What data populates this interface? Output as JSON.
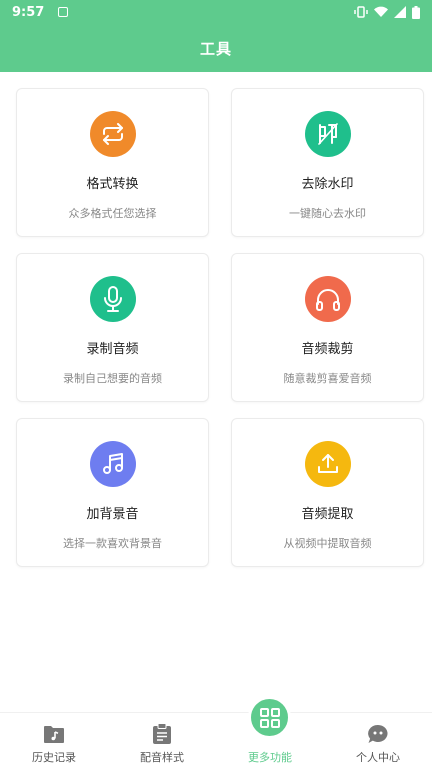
{
  "status_bar": {
    "time": "9:57"
  },
  "header": {
    "title": "工具"
  },
  "tools": [
    {
      "name": "格式转换",
      "desc": "众多格式任您选择",
      "icon": "format-convert-icon",
      "color": "#f08a2a"
    },
    {
      "name": "去除水印",
      "desc": "一键随心去水印",
      "icon": "remove-watermark-icon",
      "color": "#1fbf8c"
    },
    {
      "name": "录制音频",
      "desc": "录制自己想要的音频",
      "icon": "microphone-icon",
      "color": "#1fbf8c"
    },
    {
      "name": "音频裁剪",
      "desc": "随意裁剪喜爱音频",
      "icon": "headphones-icon",
      "color": "#f06a4c"
    },
    {
      "name": "加背景音",
      "desc": "选择一款喜欢背景音",
      "icon": "music-note-icon",
      "color": "#6e7df0"
    },
    {
      "name": "音频提取",
      "desc": "从视频中提取音频",
      "icon": "upload-tray-icon",
      "color": "#f5b80f"
    }
  ],
  "tabbar": {
    "items": [
      {
        "label": "历史记录",
        "icon": "music-folder-icon"
      },
      {
        "label": "配音样式",
        "icon": "clipboard-icon"
      },
      {
        "label": "更多功能",
        "icon": "grid-icon",
        "active": true
      },
      {
        "label": "个人中心",
        "icon": "user-bubble-icon"
      }
    ]
  },
  "colors": {
    "accent": "#5ecb8d",
    "tab_icon": "#777777"
  }
}
